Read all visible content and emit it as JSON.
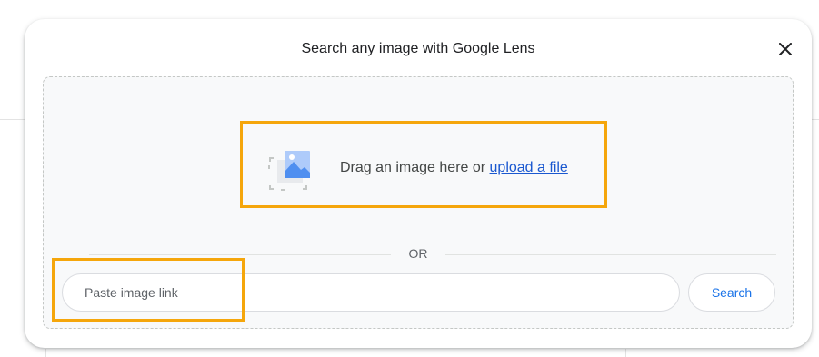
{
  "dialog": {
    "title": "Search any image with Google Lens",
    "close_icon": "close-icon"
  },
  "drop_zone": {
    "icon": "image-placeholder-icon",
    "prompt_text": "Drag an image here or ",
    "upload_link_label": "upload a file"
  },
  "divider": {
    "label": "OR"
  },
  "link_search": {
    "input_value": "",
    "input_placeholder": "Paste image link",
    "search_button_label": "Search"
  },
  "colors": {
    "highlight": "#f5a60b",
    "link": "#1a58d0",
    "search_button_text": "#1a73e8"
  }
}
